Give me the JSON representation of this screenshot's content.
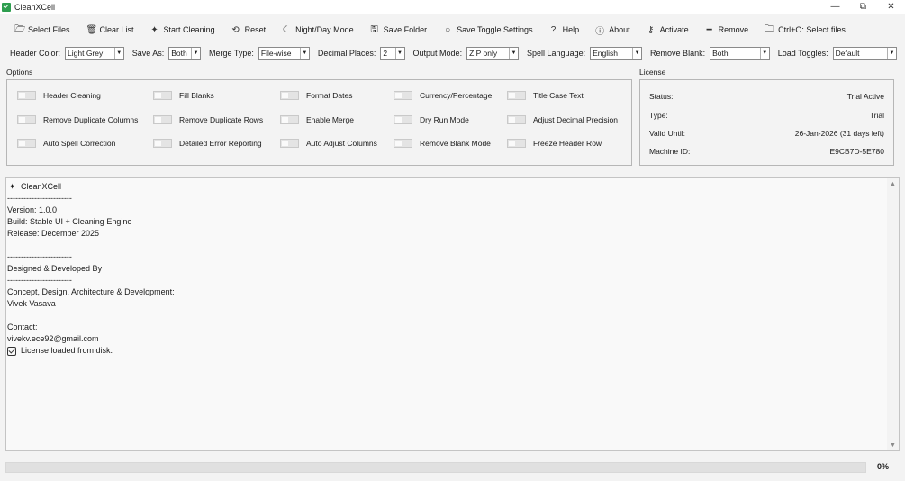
{
  "window": {
    "title": "CleanXCell",
    "minimize": "—",
    "restore": "⧉",
    "close": "✕"
  },
  "toolbar": [
    {
      "label": "Select Files",
      "icon": "folder-open-icon",
      "glyph": "🗁"
    },
    {
      "label": "Clear List",
      "icon": "trash-icon",
      "glyph": "🗑"
    },
    {
      "label": "Start Cleaning",
      "icon": "sparkle-icon",
      "glyph": "✦"
    },
    {
      "label": "Reset",
      "icon": "reset-icon",
      "glyph": "⟲"
    },
    {
      "label": "Night/Day Mode",
      "icon": "moon-icon",
      "glyph": "☾"
    },
    {
      "label": "Save Folder",
      "icon": "save-icon",
      "glyph": "🖫"
    },
    {
      "label": "Save Toggle Settings",
      "icon": "circle-icon",
      "glyph": "○"
    },
    {
      "label": "Help",
      "icon": "question-icon",
      "glyph": "?"
    },
    {
      "label": "About",
      "icon": "info-icon",
      "glyph": "ⓘ"
    },
    {
      "label": "Activate",
      "icon": "key-icon",
      "glyph": "⚷"
    },
    {
      "label": "Remove",
      "icon": "minus-icon",
      "glyph": "━"
    },
    {
      "label": "Ctrl+O: Select files",
      "icon": "folder-icon",
      "glyph": "🗀"
    }
  ],
  "options_row": {
    "header_color": {
      "label": "Header Color:",
      "value": "Light Grey"
    },
    "save_as": {
      "label": "Save As:",
      "value": "Both"
    },
    "merge_type": {
      "label": "Merge Type:",
      "value": "File-wise"
    },
    "decimal_places": {
      "label": "Decimal Places:",
      "value": "2"
    },
    "output_mode": {
      "label": "Output Mode:",
      "value": "ZIP only"
    },
    "spell_language": {
      "label": "Spell Language:",
      "value": "English"
    },
    "remove_blank": {
      "label": "Remove Blank:",
      "value": "Both"
    },
    "load_toggles": {
      "label": "Load Toggles:",
      "value": "Default"
    }
  },
  "options": {
    "title": "Options",
    "toggles": [
      {
        "label": "Header Cleaning",
        "on": false
      },
      {
        "label": "Fill Blanks",
        "on": false
      },
      {
        "label": "Format Dates",
        "on": false
      },
      {
        "label": "Currency/Percentage",
        "on": false
      },
      {
        "label": "Title Case Text",
        "on": false
      },
      {
        "label": "Remove Duplicate Columns",
        "on": false
      },
      {
        "label": "Remove Duplicate Rows",
        "on": false
      },
      {
        "label": "Enable Merge",
        "on": false
      },
      {
        "label": "Dry Run Mode",
        "on": false
      },
      {
        "label": "Adjust Decimal Precision",
        "on": false
      },
      {
        "label": "Auto Spell Correction",
        "on": false
      },
      {
        "label": "Detailed Error Reporting",
        "on": false
      },
      {
        "label": "Auto Adjust Columns",
        "on": false
      },
      {
        "label": "Remove Blank Mode",
        "on": false
      },
      {
        "label": "Freeze Header Row",
        "on": false
      }
    ]
  },
  "license": {
    "title": "License",
    "rows": [
      {
        "key": "Status:",
        "value": "Trial Active"
      },
      {
        "key": "Type:",
        "value": "Trial"
      },
      {
        "key": "Valid Until:",
        "value": "26-Jan-2026 (31 days left)"
      },
      {
        "key": "Machine ID:",
        "value": "E9CB7D-5E780"
      }
    ]
  },
  "console": {
    "lines": [
      {
        "text": "CleanXCell",
        "icon": "sparkle-icon"
      },
      {
        "text": "------------------------"
      },
      {
        "text": "Version: 1.0.0"
      },
      {
        "text": "Build: Stable UI + Cleaning Engine"
      },
      {
        "text": "Release: December 2025"
      },
      {
        "text": ""
      },
      {
        "text": "------------------------"
      },
      {
        "text": "Designed & Developed By"
      },
      {
        "text": "------------------------"
      },
      {
        "text": "Concept, Design, Architecture & Development:"
      },
      {
        "text": "Vivek Vasava"
      },
      {
        "text": ""
      },
      {
        "text": "Contact:"
      },
      {
        "text": "vivekv.ece92@gmail.com"
      },
      {
        "text": "License loaded from disk.",
        "icon": "checkbox-icon"
      }
    ]
  },
  "progress": {
    "percent_label": "0%",
    "fraction": 0
  }
}
